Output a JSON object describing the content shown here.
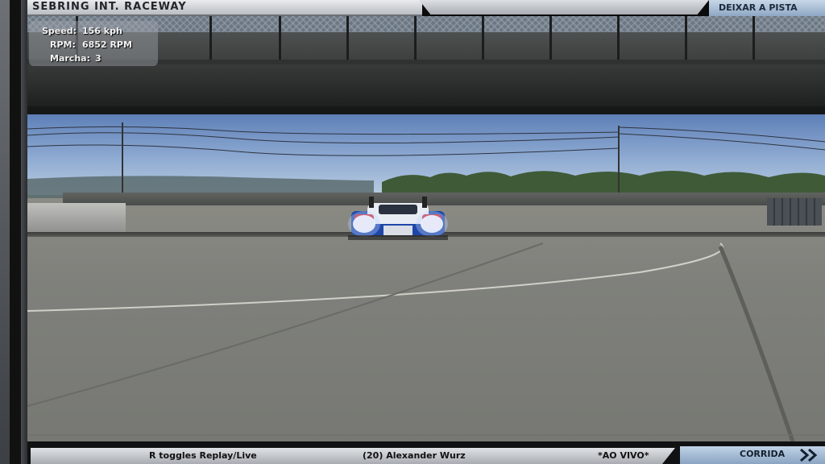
{
  "header": {
    "track_name": "SEBRING INT. RACEWAY",
    "leave_track_label": "DEIXAR A PISTA"
  },
  "telemetry": {
    "speed_label": "Speed:",
    "speed_value": "156 kph",
    "rpm_label": "RPM:",
    "rpm_value": "6852 RPM",
    "gear_label": "Marcha:",
    "gear_value": "3"
  },
  "footer": {
    "replay_hint": "R toggles Replay/Live",
    "driver": "(20) Alexander Wurz",
    "mode": "*AO VIVO*",
    "race_label": "CORRIDA"
  },
  "icons": {
    "next": "double-chevron-right-icon"
  },
  "colors": {
    "tab_blue": "#a9bfd9",
    "tab_silver": "#d2d5d9"
  }
}
